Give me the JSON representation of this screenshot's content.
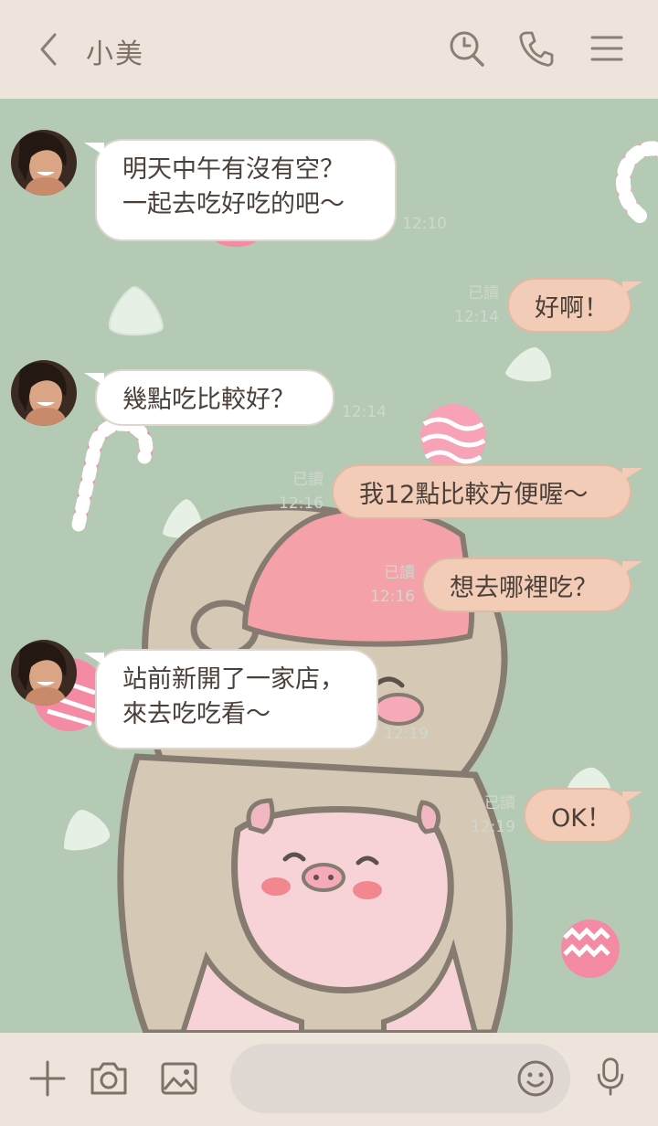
{
  "header": {
    "title": "小美",
    "icons": [
      "back-arrow-icon",
      "search-icon",
      "phone-icon",
      "menu-icon"
    ]
  },
  "messages": [
    {
      "direction": "in",
      "text": "明天中午有沒有空？\n一起去吃好吃的吧～",
      "time": "12:10"
    },
    {
      "direction": "out",
      "text": "好啊！",
      "read": "已讀",
      "time": "12:14"
    },
    {
      "direction": "in",
      "text": "幾點吃比較好？",
      "time": "12:14"
    },
    {
      "direction": "out",
      "text": "我12點比較方便喔～",
      "read": "已讀",
      "time": "12:16"
    },
    {
      "direction": "out",
      "text": "想去哪裡吃？",
      "read": "已讀",
      "time": "12:16"
    },
    {
      "direction": "in",
      "text": "站前新開了一家店，\n來去吃吃看～",
      "time": "12:19"
    },
    {
      "direction": "out",
      "text": "OK！",
      "read": "已讀",
      "time": "12:19"
    }
  ],
  "footer": {
    "input_placeholder": "",
    "icons": [
      "plus-icon",
      "camera-icon",
      "image-icon",
      "emoji-icon",
      "microphone-icon"
    ]
  },
  "colors": {
    "background": "#b5cab4",
    "header": "#ede4dc",
    "incoming_bubble": "#ffffff",
    "outgoing_bubble": "#f2ccb6",
    "text": "#4a4039"
  }
}
